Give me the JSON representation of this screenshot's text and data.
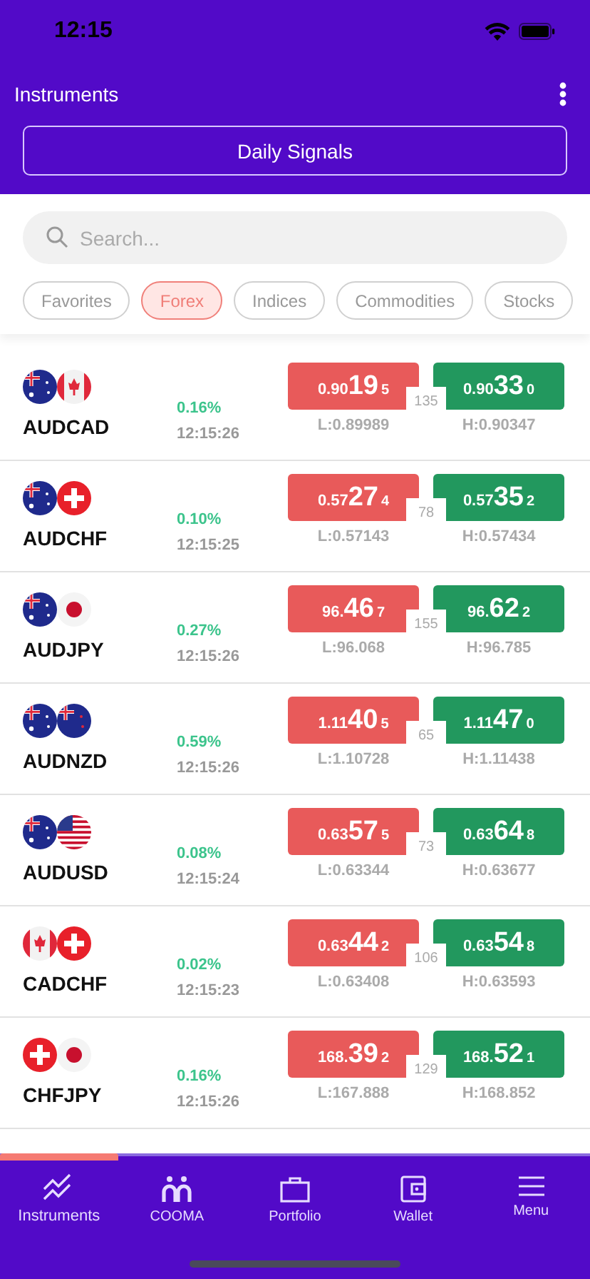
{
  "status_bar": {
    "time": "12:15"
  },
  "header": {
    "title": "Instruments",
    "signals_button": "Daily Signals"
  },
  "search": {
    "placeholder": "Search..."
  },
  "filters": [
    {
      "label": "Favorites",
      "selected": false
    },
    {
      "label": "Forex",
      "selected": true
    },
    {
      "label": "Indices",
      "selected": false
    },
    {
      "label": "Commodities",
      "selected": false
    },
    {
      "label": "Stocks",
      "selected": false
    }
  ],
  "instruments": [
    {
      "symbol": "AUDCAD",
      "flags": [
        {
          "kind": "au"
        },
        {
          "kind": "ca"
        }
      ],
      "change": "0.16%",
      "time": "12:15:26",
      "bid": {
        "small": "0.90",
        "big": "19",
        "sup": "5"
      },
      "ask": {
        "small": "0.90",
        "big": "33",
        "sup": "0"
      },
      "spread": "135",
      "low": "L:0.89989",
      "high": "H:0.90347"
    },
    {
      "symbol": "AUDCHF",
      "flags": [
        {
          "kind": "au"
        },
        {
          "kind": "ch"
        }
      ],
      "change": "0.10%",
      "time": "12:15:25",
      "bid": {
        "small": "0.57",
        "big": "27",
        "sup": "4"
      },
      "ask": {
        "small": "0.57",
        "big": "35",
        "sup": "2"
      },
      "spread": "78",
      "low": "L:0.57143",
      "high": "H:0.57434"
    },
    {
      "symbol": "AUDJPY",
      "flags": [
        {
          "kind": "au"
        },
        {
          "kind": "jp"
        }
      ],
      "change": "0.27%",
      "time": "12:15:26",
      "bid": {
        "small": "96.",
        "big": "46",
        "sup": "7"
      },
      "ask": {
        "small": "96.",
        "big": "62",
        "sup": "2"
      },
      "spread": "155",
      "low": "L:96.068",
      "high": "H:96.785"
    },
    {
      "symbol": "AUDNZD",
      "flags": [
        {
          "kind": "au"
        },
        {
          "kind": "nz"
        }
      ],
      "change": "0.59%",
      "time": "12:15:26",
      "bid": {
        "small": "1.11",
        "big": "40",
        "sup": "5"
      },
      "ask": {
        "small": "1.11",
        "big": "47",
        "sup": "0"
      },
      "spread": "65",
      "low": "L:1.10728",
      "high": "H:1.11438"
    },
    {
      "symbol": "AUDUSD",
      "flags": [
        {
          "kind": "au"
        },
        {
          "kind": "us"
        }
      ],
      "change": "0.08%",
      "time": "12:15:24",
      "bid": {
        "small": "0.63",
        "big": "57",
        "sup": "5"
      },
      "ask": {
        "small": "0.63",
        "big": "64",
        "sup": "8"
      },
      "spread": "73",
      "low": "L:0.63344",
      "high": "H:0.63677"
    },
    {
      "symbol": "CADCHF",
      "flags": [
        {
          "kind": "ca"
        },
        {
          "kind": "ch"
        }
      ],
      "change": "0.02%",
      "time": "12:15:23",
      "bid": {
        "small": "0.63",
        "big": "44",
        "sup": "2"
      },
      "ask": {
        "small": "0.63",
        "big": "54",
        "sup": "8"
      },
      "spread": "106",
      "low": "L:0.63408",
      "high": "H:0.63593"
    },
    {
      "symbol": "CHFJPY",
      "flags": [
        {
          "kind": "ch"
        },
        {
          "kind": "jp"
        }
      ],
      "change": "0.16%",
      "time": "12:15:26",
      "bid": {
        "small": "168.",
        "big": "39",
        "sup": "2"
      },
      "ask": {
        "small": "168.",
        "big": "52",
        "sup": "1"
      },
      "spread": "129",
      "low": "L:167.888",
      "high": "H:168.852"
    }
  ],
  "bottom_nav": [
    {
      "label": "Instruments",
      "selected": true
    },
    {
      "label": "COOMA",
      "selected": false
    },
    {
      "label": "Portfolio",
      "selected": false
    },
    {
      "label": "Wallet",
      "selected": false
    },
    {
      "label": "Menu",
      "selected": false
    }
  ]
}
